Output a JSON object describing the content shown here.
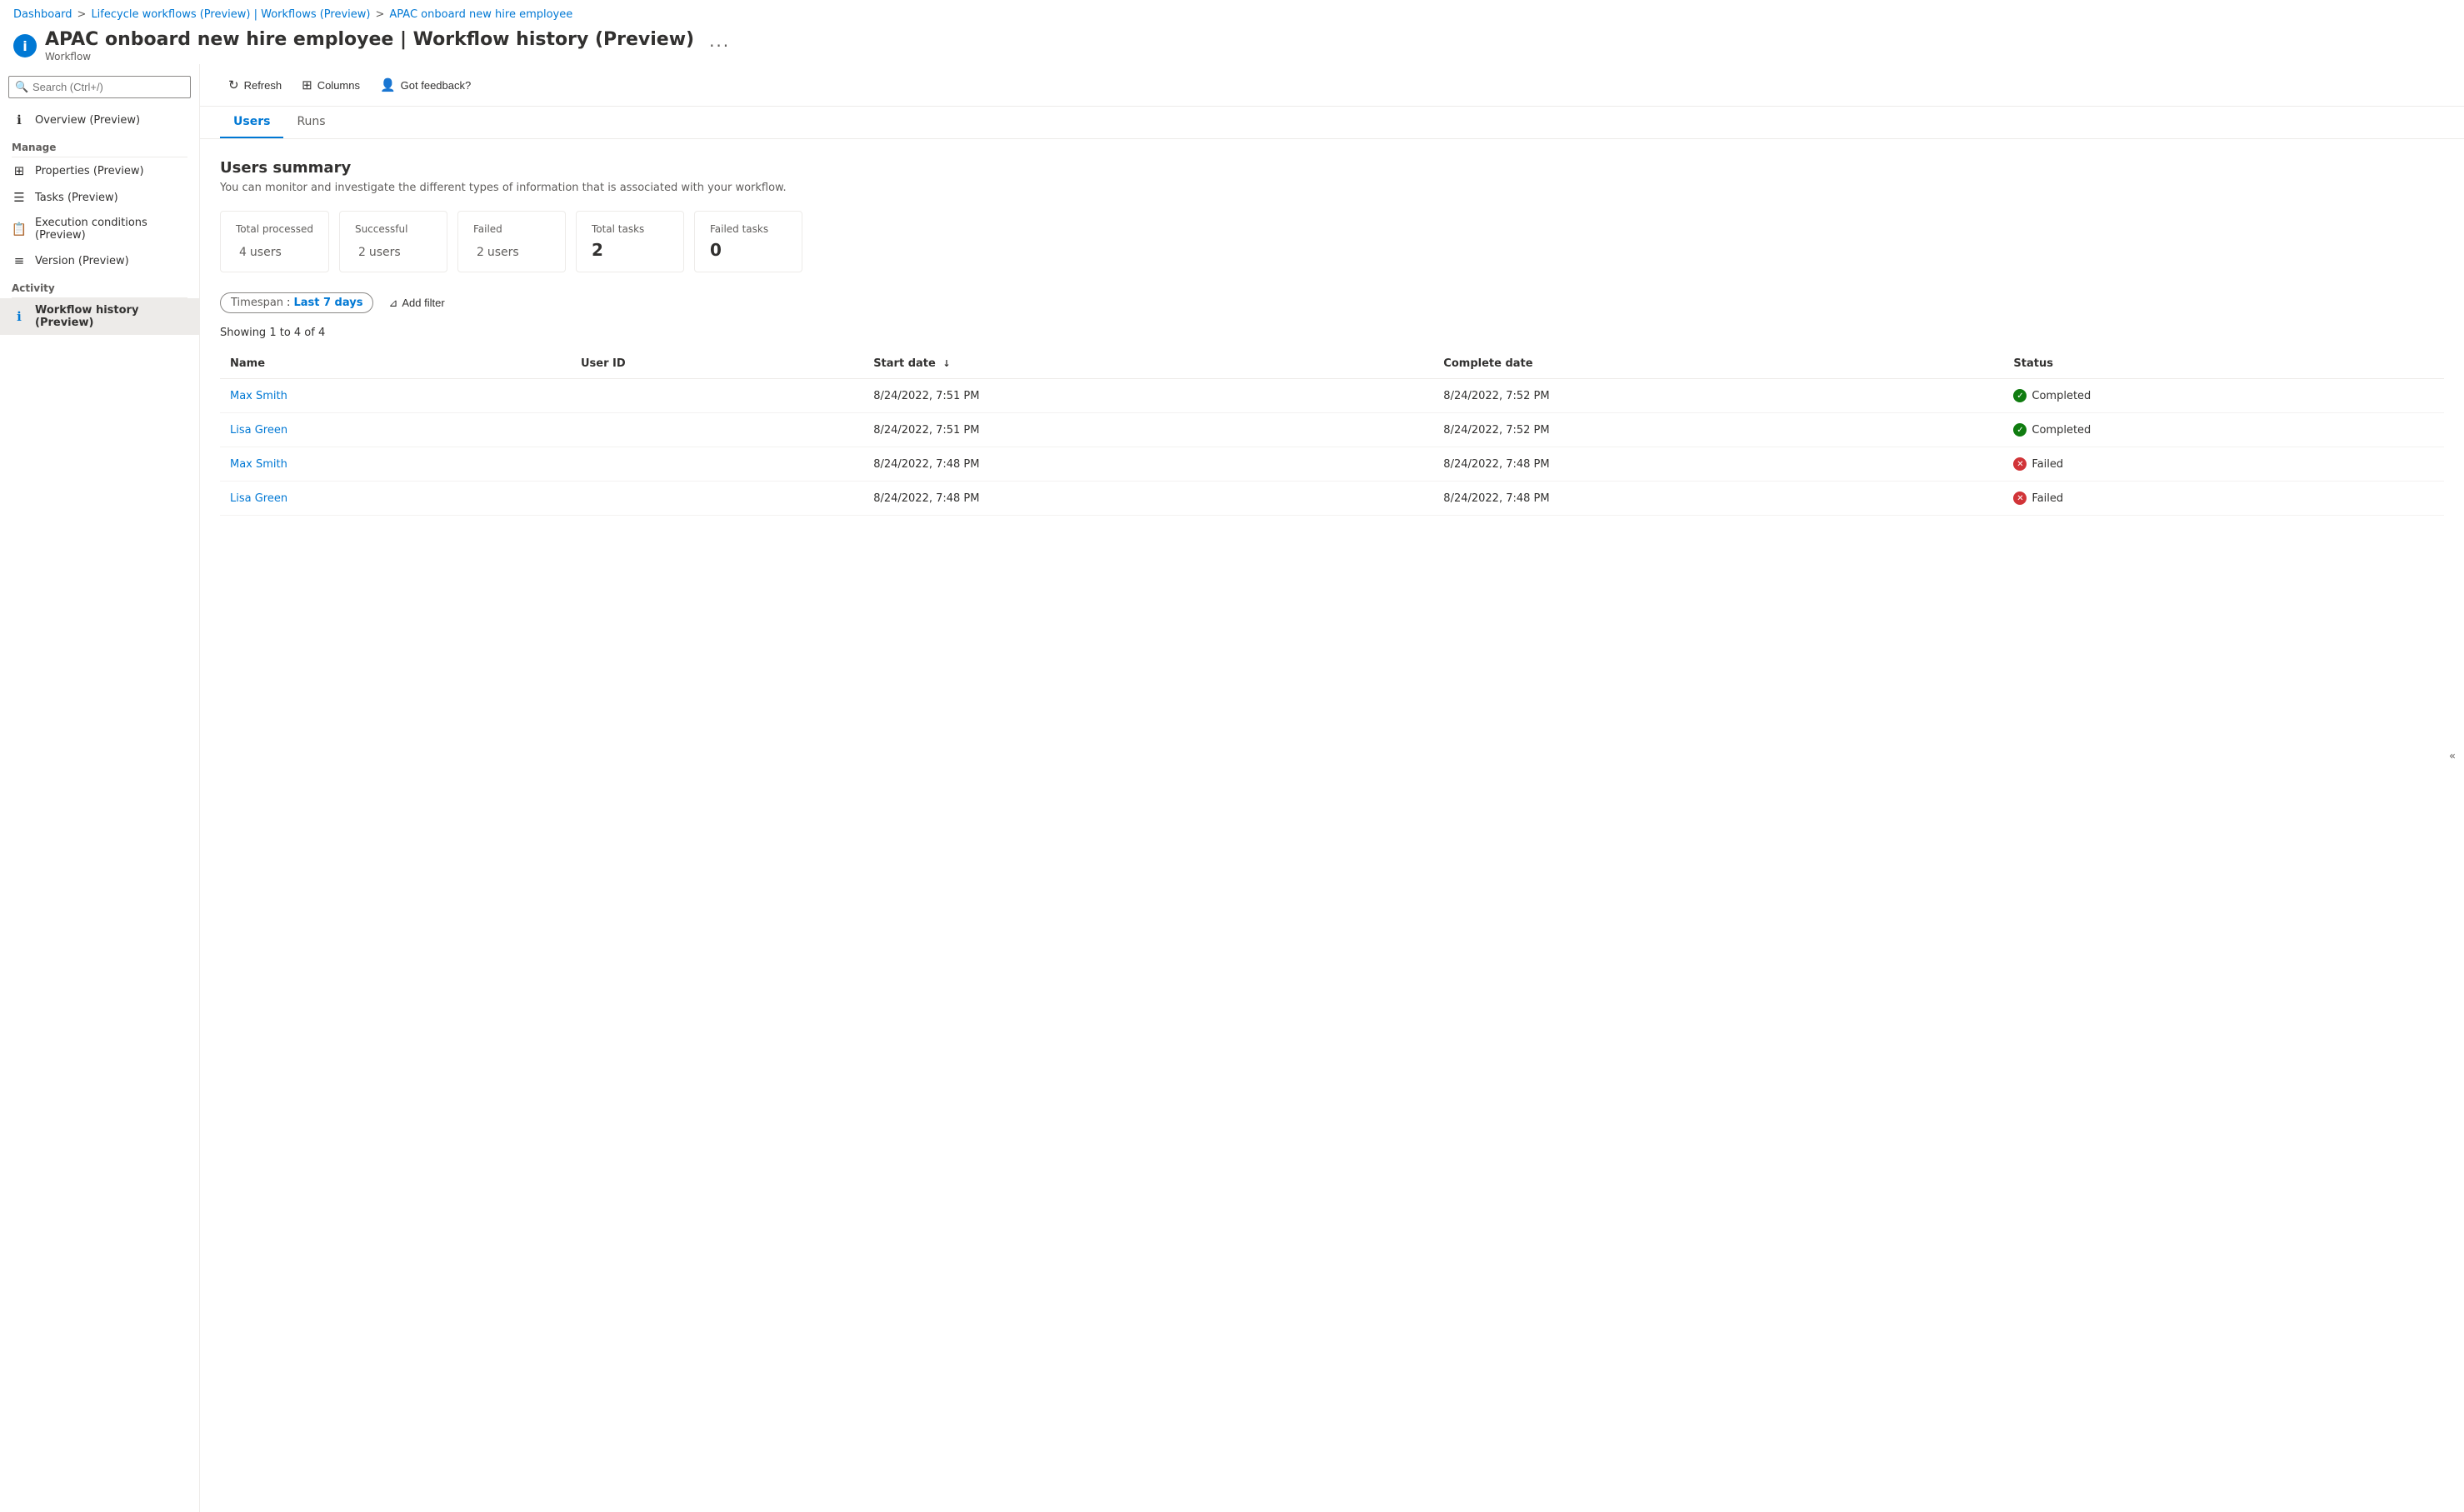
{
  "breadcrumb": {
    "items": [
      {
        "label": "Dashboard",
        "href": "#"
      },
      {
        "label": "Lifecycle workflows (Preview) | Workflows (Preview)",
        "href": "#"
      },
      {
        "label": "APAC onboard new hire employee",
        "href": "#"
      }
    ],
    "separator": ">"
  },
  "pageHeader": {
    "icon": "i",
    "title": "APAC onboard new hire employee | Workflow history (Preview)",
    "subtitle": "Workflow",
    "dotsLabel": "···"
  },
  "toolbar": {
    "refreshLabel": "Refresh",
    "columnsLabel": "Columns",
    "feedbackLabel": "Got feedback?"
  },
  "tabs": [
    {
      "label": "Users",
      "active": true
    },
    {
      "label": "Runs",
      "active": false
    }
  ],
  "search": {
    "placeholder": "Search (Ctrl+/)"
  },
  "sidebar": {
    "collapseIcon": "«",
    "overviewItem": "Overview (Preview)",
    "sectionManage": "Manage",
    "manageItems": [
      {
        "label": "Properties (Preview)",
        "icon": "≡≡"
      },
      {
        "label": "Tasks (Preview)",
        "icon": "≡"
      },
      {
        "label": "Execution conditions (Preview)",
        "icon": "📄"
      },
      {
        "label": "Version (Preview)",
        "icon": "≡"
      }
    ],
    "sectionActivity": "Activity",
    "activityItems": [
      {
        "label": "Workflow history (Preview)",
        "icon": "ℹ",
        "active": true
      }
    ]
  },
  "usersSummary": {
    "title": "Users summary",
    "description": "You can monitor and investigate the different types of information that is associated with your workflow.",
    "cards": [
      {
        "label": "Total processed",
        "value": "4",
        "unit": "users"
      },
      {
        "label": "Successful",
        "value": "2",
        "unit": "users"
      },
      {
        "label": "Failed",
        "value": "2",
        "unit": "users"
      },
      {
        "label": "Total tasks",
        "value": "2",
        "unit": ""
      },
      {
        "label": "Failed tasks",
        "value": "0",
        "unit": ""
      }
    ]
  },
  "filters": {
    "timespanKey": "Timespan",
    "timespanSeparator": " : ",
    "timespanValue": "Last 7 days",
    "addFilterLabel": "Add filter"
  },
  "table": {
    "showingText": "Showing 1 to 4 of 4",
    "columns": [
      {
        "label": "Name",
        "sortable": false
      },
      {
        "label": "User ID",
        "sortable": false
      },
      {
        "label": "Start date",
        "sortable": true,
        "sortDir": "↓"
      },
      {
        "label": "Complete date",
        "sortable": false
      },
      {
        "label": "Status",
        "sortable": false
      }
    ],
    "rows": [
      {
        "name": "Max Smith",
        "userId": "",
        "startDate": "8/24/2022, 7:51 PM",
        "completeDate": "8/24/2022, 7:52 PM",
        "status": "Completed",
        "statusType": "completed"
      },
      {
        "name": "Lisa Green",
        "userId": "",
        "startDate": "8/24/2022, 7:51 PM",
        "completeDate": "8/24/2022, 7:52 PM",
        "status": "Completed",
        "statusType": "completed"
      },
      {
        "name": "Max Smith",
        "userId": "",
        "startDate": "8/24/2022, 7:48 PM",
        "completeDate": "8/24/2022, 7:48 PM",
        "status": "Failed",
        "statusType": "failed"
      },
      {
        "name": "Lisa Green",
        "userId": "",
        "startDate": "8/24/2022, 7:48 PM",
        "completeDate": "8/24/2022, 7:48 PM",
        "status": "Failed",
        "statusType": "failed"
      }
    ]
  },
  "colors": {
    "accent": "#0078d4",
    "success": "#107c10",
    "error": "#d13438",
    "border": "#edebe9",
    "subtle": "#605e5c"
  }
}
